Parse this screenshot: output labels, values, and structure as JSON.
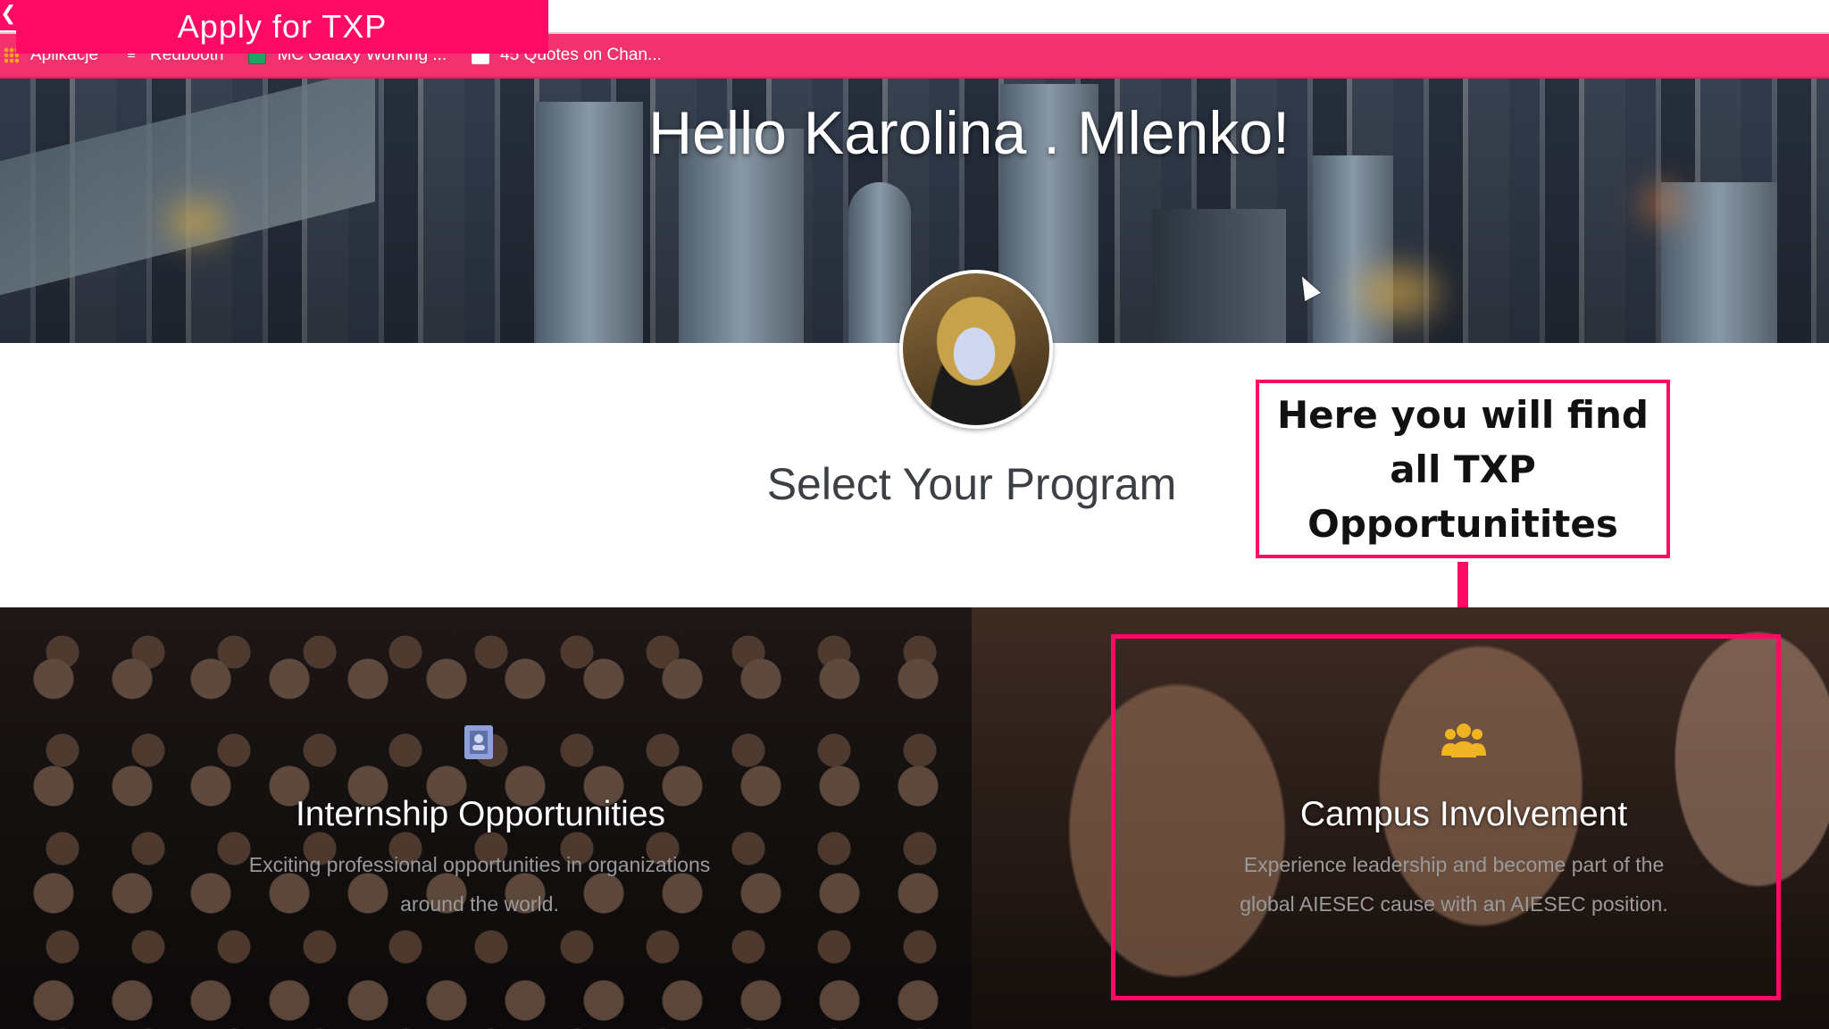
{
  "overlay": {
    "title": "Apply for TXP"
  },
  "bookmarks": [
    {
      "label": "Aplikacje",
      "icon": "apps-grid-icon"
    },
    {
      "label": "Redbooth",
      "icon": "redbooth-icon"
    },
    {
      "label": "MC Galaxy Working ...",
      "icon": "spreadsheet-icon"
    },
    {
      "label": "45 Quotes on Chan...",
      "icon": "page-icon"
    }
  ],
  "hero": {
    "greeting": "Hello Karolina . Mlenko!"
  },
  "main": {
    "select_title": "Select Your Program"
  },
  "callout": {
    "text": "Here you will find\nall TXP\nOpportunitites"
  },
  "programs": [
    {
      "title": "Internship Opportunities",
      "description": "Exciting professional opportunities in organizations around the world.",
      "icon": "id-card-icon",
      "icon_color": "#8fa0d8"
    },
    {
      "title": "Campus Involvement",
      "description": "Experience leadership and become part of the global AIESEC cause with an AIESEC position.",
      "icon": "users-group-icon",
      "icon_color": "#f0b323"
    }
  ],
  "colors": {
    "accent": "#ff0b66",
    "bookmark_bar": "#f2326f"
  }
}
